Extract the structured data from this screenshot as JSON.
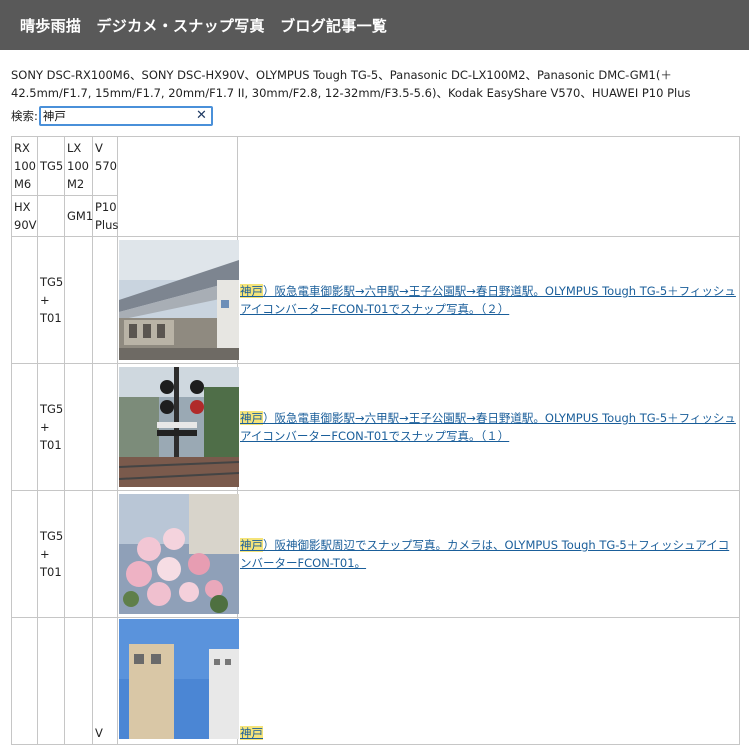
{
  "header": {
    "title": "晴歩雨描　デジカメ・スナップ写真　ブログ記事一覧"
  },
  "devices_text": "SONY DSC-RX100M6、SONY DSC-HX90V、OLYMPUS Tough TG-5、Panasonic DC-LX100M2、Panasonic DMC-GM1(＋42.5mm/F1.7, 15mm/F1.7, 20mm/F1.7 II, 30mm/F2.8, 12-32mm/F3.5-5.6)、Kodak EasyShare V570、HUAWEI P10 Plus",
  "search": {
    "label": "検索:",
    "value": "神戸",
    "clear_icon": "close-icon"
  },
  "table": {
    "header_row1": [
      "RX 100 M6",
      "TG5",
      "LX 100 M2",
      "V 570"
    ],
    "header_row2": [
      "HX 90V",
      "GM1",
      "P10 Plus"
    ],
    "rows": [
      {
        "tg5": "TG5 + T01",
        "thumb": "street-station-photo",
        "keyword": "神戸",
        "link_text": "）阪急電車御影駅→六甲駅→王子公園駅→春日野道駅。OLYMPUS Tough TG-5＋フィッシュアイコンバーターFCON-T01でスナップ写真。（２）"
      },
      {
        "tg5": "TG5 + T01",
        "thumb": "railway-crossing-photo",
        "keyword": "神戸",
        "link_text": "）阪急電車御影駅→六甲駅→王子公園駅→春日野道駅。OLYMPUS Tough TG-5＋フィッシュアイコンバーターFCON-T01でスナップ写真。（１）"
      },
      {
        "tg5": "TG5 + T01",
        "thumb": "flowers-photo",
        "keyword": "神戸",
        "link_text": "）阪神御影駅周辺でスナップ写真。カメラは、OLYMPUS Tough TG-5＋フィッシュアイコンバーターFCON-T01。"
      },
      {
        "v570": "V",
        "thumb": "building-sky-photo",
        "keyword": "神戸"
      }
    ]
  },
  "colors": {
    "header_bg": "#595959",
    "link": "#1a5e9a",
    "highlight": "#f5e47a",
    "search_border": "#4a90d9"
  }
}
